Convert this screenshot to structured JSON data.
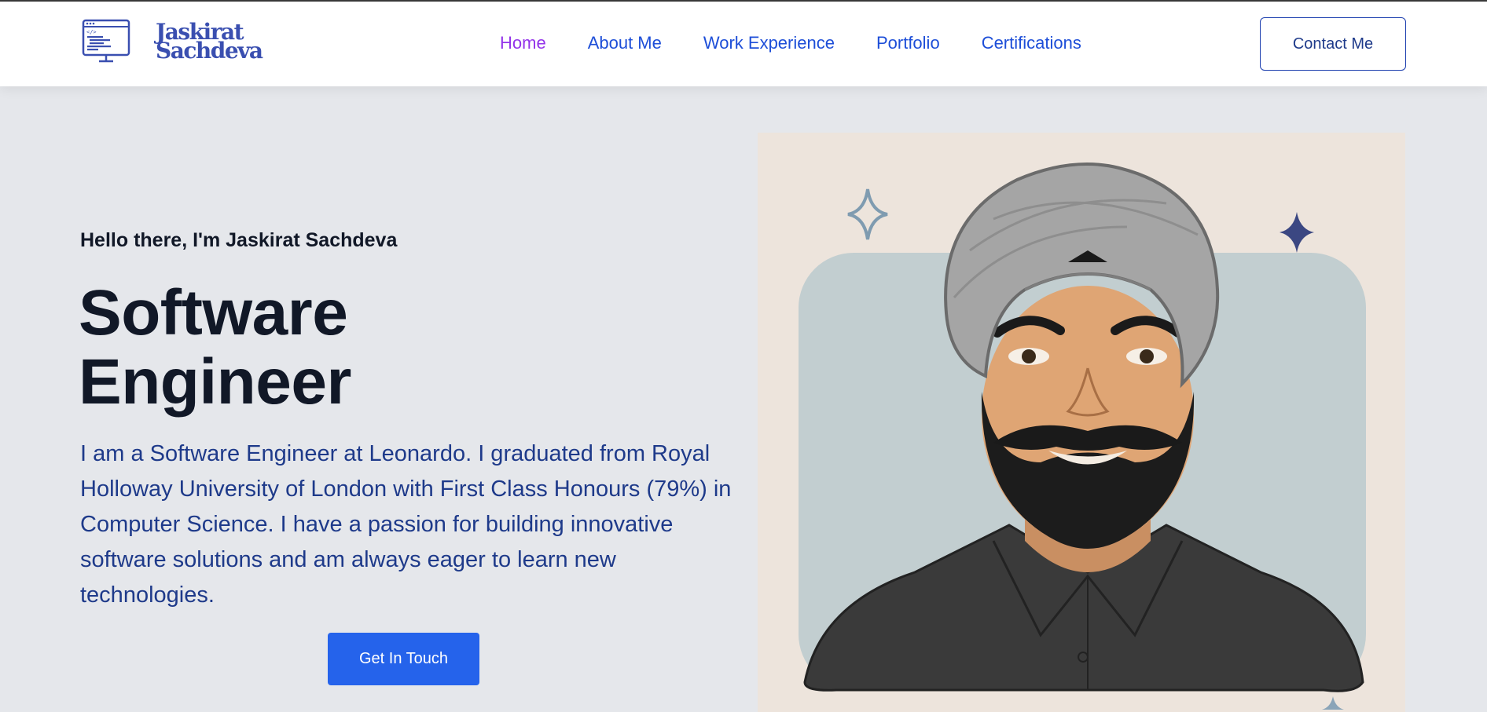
{
  "header": {
    "logo": {
      "line1": "Jaskirat",
      "line2": "Sachdeva"
    },
    "nav": [
      {
        "label": "Home",
        "active": true
      },
      {
        "label": "About Me",
        "active": false
      },
      {
        "label": "Work Experience",
        "active": false
      },
      {
        "label": "Portfolio",
        "active": false
      },
      {
        "label": "Certifications",
        "active": false
      }
    ],
    "contact_label": "Contact Me"
  },
  "hero": {
    "greeting": "Hello there, I'm Jaskirat Sachdeva",
    "title_line1": "Software",
    "title_line2": "Engineer",
    "description": "I am a Software Engineer at Leonardo. I graduated from Royal Holloway University of London with First Class Honours (79%) in Computer Science. I have a passion for building innovative software solutions and am always eager to learn new technologies.",
    "cta_label": "Get In Touch"
  },
  "colors": {
    "accent": "#2563eb",
    "nav_link": "#1d4ed8",
    "nav_active": "#9333ea",
    "heading": "#111827",
    "body_text": "#1e3a8a",
    "hero_bg": "#e5e7eb",
    "portrait_bg": "#ede4dc"
  },
  "icons": {
    "logo": "code-monitor-icon",
    "sparkle": "sparkle-icon"
  }
}
